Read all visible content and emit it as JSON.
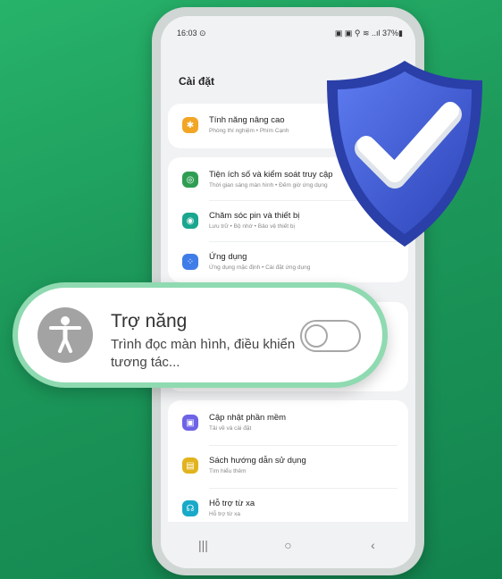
{
  "status": {
    "time": "16:03 ⊙",
    "right": "▣ ▣ ⚲ ≋ ..ıl 37%▮"
  },
  "page_title": "Cài đặt",
  "items": [
    {
      "title": "Tính năng nâng cao",
      "sub": "Phòng thí nghiệm • Phím Cạnh",
      "color": "#f2a624",
      "icon": "gear-icon"
    },
    {
      "title": "Tiện ích số và kiểm soát truy cập",
      "sub": "Thời gian sáng màn hình • Đếm giờ ứng dụng",
      "color": "#2f9e53",
      "icon": "wellbeing-icon"
    },
    {
      "title": "Chăm sóc pin và thiết bị",
      "sub": "Lưu trữ • Bộ nhớ • Bảo vệ thiết bị",
      "color": "#1aa68f",
      "icon": "device-care-icon"
    },
    {
      "title": "Ứng dụng",
      "sub": "Ứng dụng mặc định • Cài đặt ứng dụng",
      "color": "#3f7de8",
      "icon": "apps-icon"
    },
    {
      "title": "Cập nhật phần mềm",
      "sub": "Tải về và cài đặt",
      "color": "#6d63e6",
      "icon": "software-update-icon"
    },
    {
      "title": "Sách hướng dẫn sử dụng",
      "sub": "Tìm hiểu thêm",
      "color": "#e2b31c",
      "icon": "manual-icon"
    },
    {
      "title": "Hỗ trợ từ xa",
      "sub": "Hỗ trợ từ xa",
      "color": "#19a9c9",
      "icon": "headset-icon"
    }
  ],
  "popup": {
    "title": "Trợ năng",
    "sub": "Trình đọc màn hình, điều khiển tương tác...",
    "toggle_on": false
  },
  "nav": {
    "recents": "|||",
    "home": "○",
    "back": "‹"
  },
  "colors": {
    "shield": "#3c5bd6",
    "popup_border": "#8fdab1",
    "accent_green": "#1d9a5b"
  }
}
